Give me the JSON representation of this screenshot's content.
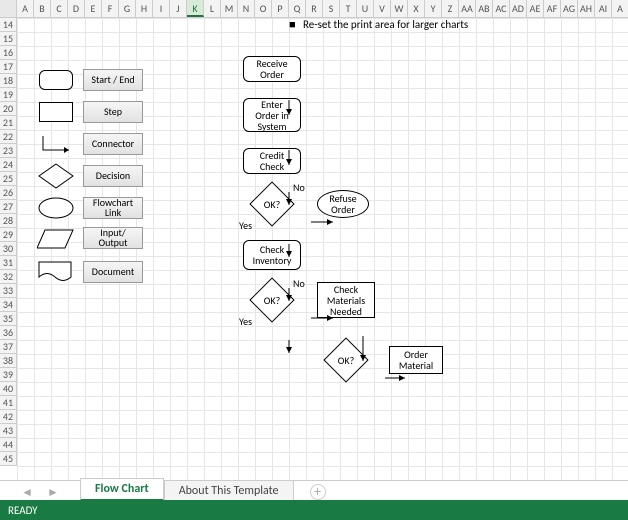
{
  "columns": [
    "A",
    "B",
    "C",
    "D",
    "E",
    "F",
    "G",
    "H",
    "I",
    "J",
    "K",
    "L",
    "M",
    "N",
    "O",
    "P",
    "Q",
    "R",
    "S",
    "T",
    "U",
    "V",
    "W",
    "X",
    "Y",
    "Z",
    "AA",
    "AB",
    "AC",
    "AD",
    "AE",
    "AF",
    "AG",
    "AH",
    "AI",
    "A"
  ],
  "selected_column_index": 10,
  "rows_start": 14,
  "rows_end": 45,
  "caption_bullet": "■",
  "caption": "Re-set the print area for larger charts",
  "legend": {
    "start_end": "Start / End",
    "step": "Step",
    "connector": "Connector",
    "decision": "Decision",
    "flowchart_link": "Flowchart Link",
    "input_output": "Input/\nOutput",
    "document": "Document"
  },
  "flow": {
    "receive_order": "Receive\nOrder",
    "enter_order": "Enter\nOrder in\nSystem",
    "credit_check": "Credit\nCheck",
    "ok": "OK?",
    "refuse_order": "Refuse\nOrder",
    "check_inventory": "Check\nInventory",
    "check_materials": "Check\nMaterials\nNeeded",
    "order_material": "Order\nMaterial",
    "yes": "Yes",
    "no": "No"
  },
  "tabs": {
    "active": "Flow Chart",
    "other": "About This Template"
  },
  "status": "READY"
}
